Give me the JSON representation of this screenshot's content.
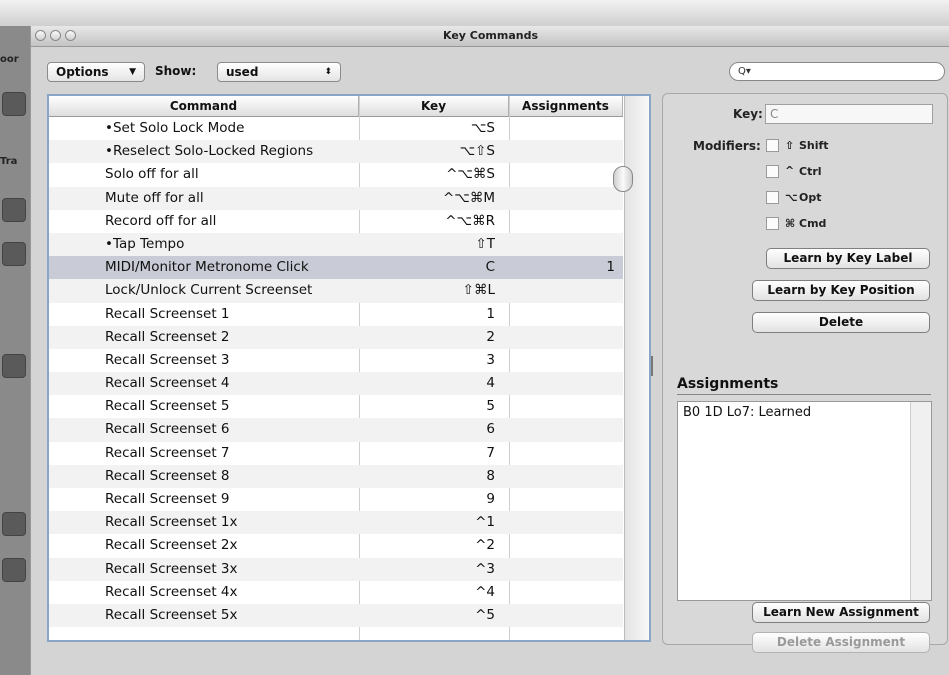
{
  "window": {
    "title": "Key Commands"
  },
  "toolbar": {
    "options_label": "Options",
    "show_label": "Show:",
    "show_value": "used",
    "search_placeholder": "Q▾"
  },
  "table": {
    "columns": [
      "Command",
      "Key",
      "Assignments"
    ],
    "rows": [
      {
        "cmd": "•Set Solo Lock Mode",
        "key": "⌥S",
        "asg": ""
      },
      {
        "cmd": "•Reselect Solo-Locked Regions",
        "key": "⌥⇧S",
        "asg": ""
      },
      {
        "cmd": "Solo off for all",
        "key": "^⌥⌘S",
        "asg": ""
      },
      {
        "cmd": "Mute off for all",
        "key": "^⌥⌘M",
        "asg": ""
      },
      {
        "cmd": "Record off for all",
        "key": "^⌥⌘R",
        "asg": ""
      },
      {
        "cmd": "•Tap Tempo",
        "key": "⇧T",
        "asg": ""
      },
      {
        "cmd": "MIDI/Monitor Metronome Click",
        "key": "C",
        "asg": "1"
      },
      {
        "cmd": "Lock/Unlock Current Screenset",
        "key": "⇧⌘L",
        "asg": ""
      },
      {
        "cmd": "Recall Screenset 1",
        "key": "1",
        "asg": ""
      },
      {
        "cmd": "Recall Screenset 2",
        "key": "2",
        "asg": ""
      },
      {
        "cmd": "Recall Screenset 3",
        "key": "3",
        "asg": ""
      },
      {
        "cmd": "Recall Screenset 4",
        "key": "4",
        "asg": ""
      },
      {
        "cmd": "Recall Screenset 5",
        "key": "5",
        "asg": ""
      },
      {
        "cmd": "Recall Screenset 6",
        "key": "6",
        "asg": ""
      },
      {
        "cmd": "Recall Screenset 7",
        "key": "7",
        "asg": ""
      },
      {
        "cmd": "Recall Screenset 8",
        "key": "8",
        "asg": ""
      },
      {
        "cmd": "Recall Screenset 9",
        "key": "9",
        "asg": ""
      },
      {
        "cmd": "Recall Screenset 1x",
        "key": "^1",
        "asg": ""
      },
      {
        "cmd": "Recall Screenset 2x",
        "key": "^2",
        "asg": ""
      },
      {
        "cmd": "Recall Screenset 3x",
        "key": "^3",
        "asg": ""
      },
      {
        "cmd": "Recall Screenset 4x",
        "key": "^4",
        "asg": ""
      },
      {
        "cmd": "Recall Screenset 5x",
        "key": "^5",
        "asg": ""
      }
    ]
  },
  "panel": {
    "key_label": "Key:",
    "key_value": "C",
    "modifiers_label": "Modifiers:",
    "modifiers": [
      {
        "symbol": "⇧",
        "name": "Shift"
      },
      {
        "symbol": "^",
        "name": "Ctrl"
      },
      {
        "symbol": "⌥",
        "name": "Opt"
      },
      {
        "symbol": "⌘",
        "name": "Cmd"
      }
    ],
    "learn_label_btn": "Learn by Key Label",
    "learn_position_btn": "Learn by Key Position",
    "delete_btn": "Delete",
    "assignments_title": "Assignments",
    "assignment_item": "B0 1D Lo7: Learned",
    "learn_new_btn": "Learn New Assignment",
    "delete_assignment_btn": "Delete Assignment"
  },
  "background": {
    "sidebar_labels": [
      "oor",
      "Tra"
    ]
  }
}
